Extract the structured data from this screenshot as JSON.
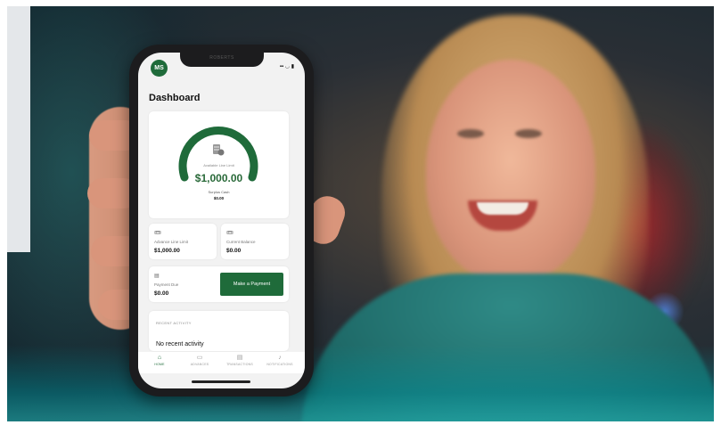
{
  "phone": {
    "notch_text": "ROBERTS",
    "avatar_initials": "MS",
    "status_icons": "▪▪ ◡ ▮"
  },
  "dashboard": {
    "title": "Dashboard",
    "gauge": {
      "label": "Available Line Limit",
      "amount": "$1,000.00",
      "sub_label": "Surplus Cash",
      "sub_value": "$0.00",
      "fill_fraction": 1.0
    },
    "advance_line_limit": {
      "label": "Advance Line Limit",
      "value": "$1,000.00"
    },
    "current_balance": {
      "label": "Current Balance",
      "value": "$0.00"
    },
    "payment_due": {
      "label": "Payment Due",
      "value": "$0.00"
    },
    "make_payment_label": "Make a Payment",
    "recent_activity": {
      "title": "RECENT ACTIVITY",
      "empty_text": "No recent activity"
    }
  },
  "tabs": [
    {
      "label": "HOME",
      "icon": "home-icon",
      "active": true
    },
    {
      "label": "ADVANCES",
      "icon": "ticket-icon",
      "active": false
    },
    {
      "label": "TRANSACTIONS",
      "icon": "receipt-icon",
      "active": false
    },
    {
      "label": "NOTIFICATIONS",
      "icon": "bell-icon",
      "active": false
    }
  ],
  "colors": {
    "brand_green": "#1f6b3a",
    "accent_teal": "#2f8a86"
  }
}
